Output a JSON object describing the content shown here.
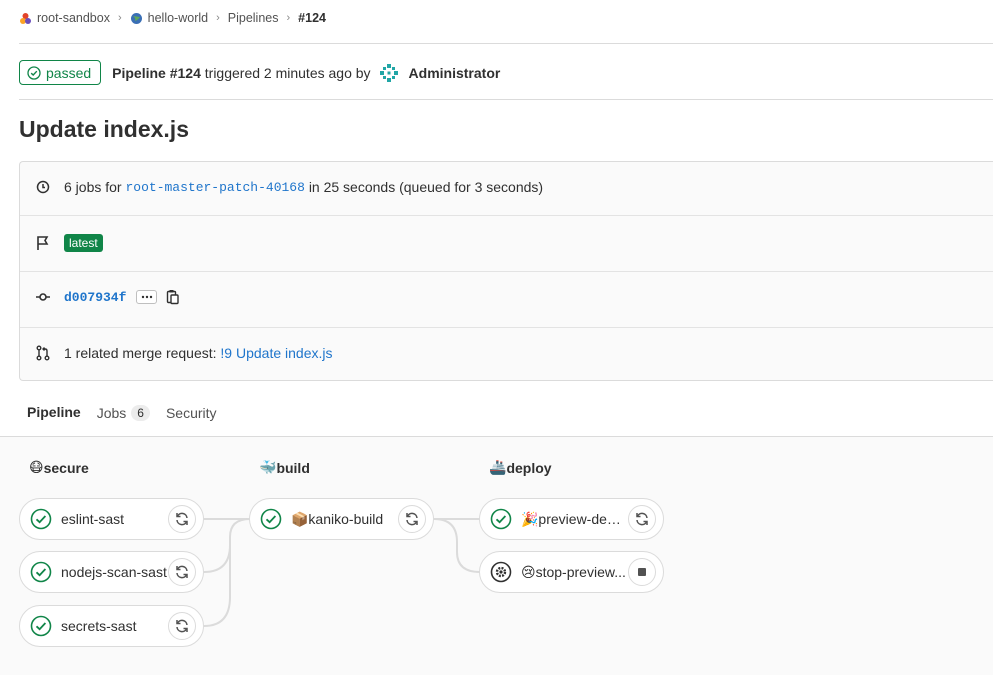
{
  "breadcrumb": {
    "items": [
      {
        "label": "root-sandbox",
        "icon": "group-avatar-icon"
      },
      {
        "label": "hello-world",
        "icon": "globe-icon"
      },
      {
        "label": "Pipelines"
      },
      {
        "label": "#124"
      }
    ]
  },
  "header": {
    "status": "passed",
    "pipeline_label": "Pipeline #124",
    "triggered_text": "triggered 2 minutes ago by",
    "user": "Administrator"
  },
  "title": "Update index.js",
  "info": {
    "jobs_prefix": "6 jobs for",
    "branch": "root-master-patch-40168",
    "jobs_suffix": "in 25 seconds (queued for 3 seconds)",
    "badge": "latest",
    "commit_sha": "d007934f",
    "mr_prefix": "1 related merge request:",
    "mr_link": "!9 Update index.js"
  },
  "tabs": [
    {
      "label": "Pipeline",
      "active": true
    },
    {
      "label": "Jobs",
      "count": "6"
    },
    {
      "label": "Security"
    }
  ],
  "stages": [
    {
      "name": "secure",
      "emoji": "😷",
      "jobs": [
        {
          "name": "eslint-sast",
          "status": "success",
          "action": "retry"
        },
        {
          "name": "nodejs-scan-sast",
          "status": "success",
          "action": "retry"
        },
        {
          "name": "secrets-sast",
          "status": "success",
          "action": "retry"
        }
      ]
    },
    {
      "name": "build",
      "emoji": "🐳",
      "jobs": [
        {
          "name": "📦kaniko-build",
          "status": "success",
          "action": "retry"
        }
      ]
    },
    {
      "name": "deploy",
      "emoji": "🚢",
      "jobs": [
        {
          "name": "🎉preview-depl...",
          "status": "success",
          "action": "retry"
        },
        {
          "name": "😢stop-preview...",
          "status": "manual",
          "action": "stop"
        }
      ]
    }
  ],
  "colors": {
    "success": "#108548",
    "accent": "#6f42c1",
    "link": "#1f75cb"
  }
}
